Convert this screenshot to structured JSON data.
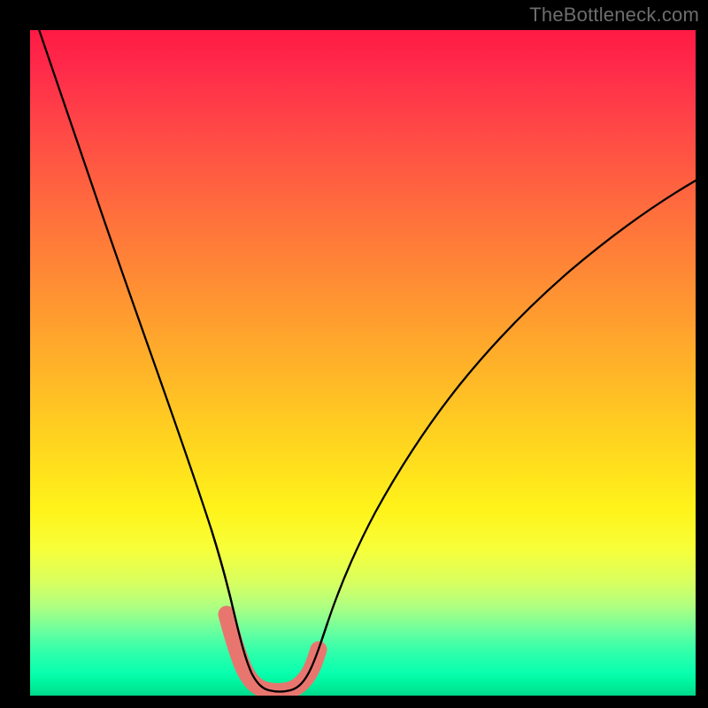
{
  "watermark": "TheBottleneck.com",
  "chart_data": {
    "type": "line",
    "title": "",
    "xlabel": "",
    "ylabel": "",
    "xlim": [
      0,
      100
    ],
    "ylim": [
      0,
      100
    ],
    "grid": false,
    "legend": false,
    "background_gradient": {
      "orientation": "vertical",
      "stops": [
        {
          "pos": 0,
          "color": "#ff1a44",
          "meaning": "severe"
        },
        {
          "pos": 50,
          "color": "#ffb129",
          "meaning": "moderate"
        },
        {
          "pos": 78,
          "color": "#f7ff3a",
          "meaning": "mild"
        },
        {
          "pos": 96,
          "color": "#0affae",
          "meaning": "optimal"
        },
        {
          "pos": 100,
          "color": "#00d888",
          "meaning": "optimal"
        }
      ]
    },
    "series": [
      {
        "name": "bottleneck-curve",
        "color": "#000000",
        "stroke_width": 2.2,
        "x": [
          0,
          3,
          6,
          9,
          12,
          15,
          18,
          21,
          24,
          27,
          29.5,
          31.5,
          33,
          35,
          37,
          39,
          41,
          43,
          46,
          50,
          55,
          60,
          66,
          73,
          81,
          90,
          100
        ],
        "values": [
          104,
          95,
          86,
          77,
          68,
          59,
          50,
          41,
          32,
          22,
          12,
          5,
          1.5,
          0.6,
          0.5,
          1.0,
          3.0,
          7.5,
          15,
          24,
          33,
          40.5,
          48,
          55,
          61.5,
          67.5,
          72.5
        ]
      },
      {
        "name": "trough-marker",
        "type": "marker-band",
        "color": "#e8766f",
        "marker_radius": 9,
        "points": [
          {
            "x": 29.5,
            "y": 12.0
          },
          {
            "x": 30.3,
            "y": 8.0
          },
          {
            "x": 31.6,
            "y": 4.2
          },
          {
            "x": 33.0,
            "y": 1.6
          },
          {
            "x": 34.4,
            "y": 0.8
          },
          {
            "x": 35.8,
            "y": 0.55
          },
          {
            "x": 37.2,
            "y": 0.55
          },
          {
            "x": 38.5,
            "y": 0.75
          },
          {
            "x": 39.7,
            "y": 1.4
          },
          {
            "x": 41.0,
            "y": 3.0
          },
          {
            "x": 42.5,
            "y": 6.5
          },
          {
            "x": 43.2,
            "y": 8.3
          }
        ]
      }
    ],
    "notes": "V-shaped curve on a red→green vertical gradient. Minimum (~0.5) near x≈36. Left branch starts above top edge (y>100 at x=0, clipped). Right branch rises to ~72.5 at x=100. A cluster of salmon-colored circular markers sits along the bottom of the V between x≈29 and x≈43."
  }
}
